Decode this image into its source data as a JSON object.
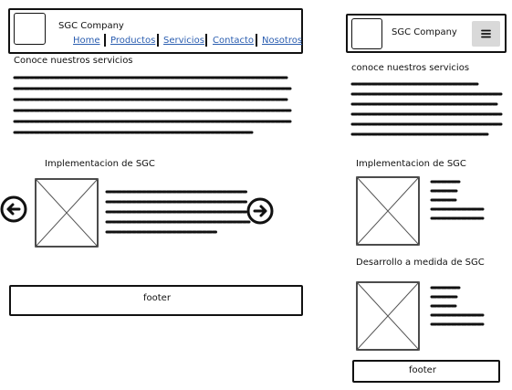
{
  "desktop": {
    "header": {
      "company_name": "SGC Company",
      "nav": [
        "Home",
        "Productos",
        "Servicios",
        "Contacto",
        "Nosotros"
      ]
    },
    "services_title": "Conoce nuestros servicios",
    "feature_title": "Implementacion de SGC",
    "footer": "footer",
    "icons": {
      "prev": "arrow-left-circle-icon",
      "next": "arrow-right-circle-icon",
      "logo": "logo-placeholder",
      "image": "image-placeholder"
    }
  },
  "mobile": {
    "header": {
      "company_name": "SGC Company",
      "menu_icon": "hamburger-menu-icon"
    },
    "services_title": "conoce nuestros servicios",
    "features": [
      {
        "title": "Implementacion de SGC"
      },
      {
        "title": "Desarrollo a medida de SGC"
      }
    ],
    "footer": "footer"
  },
  "colors": {
    "link": "#2a5db0",
    "stroke": "#111111",
    "menu_button_bg": "#d9d9d9"
  }
}
